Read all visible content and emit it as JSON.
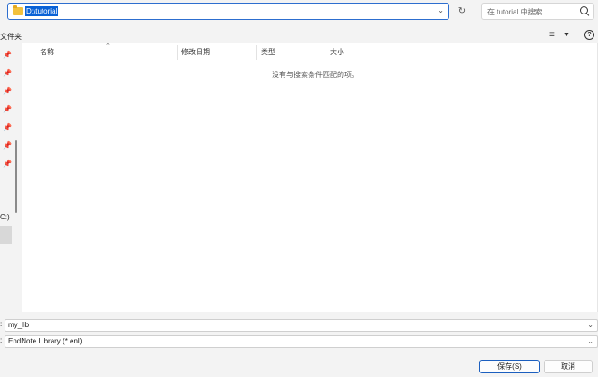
{
  "address": {
    "path": "D:\\tutorial"
  },
  "search": {
    "placeholder": "在 tutorial 中搜索"
  },
  "toolbar": {
    "left_label": "文件夹"
  },
  "nav": {
    "drive_label": "C:)"
  },
  "columns": [
    {
      "label": "名称"
    },
    {
      "label": "修改日期"
    },
    {
      "label": "类型"
    },
    {
      "label": "大小"
    }
  ],
  "file_list": {
    "empty_message": "没有与搜索条件匹配的项。"
  },
  "filename": {
    "label": ":",
    "value": "my_lib"
  },
  "filetype": {
    "label": ":",
    "value": "EndNote Library (*.enl)"
  },
  "buttons": {
    "save": "保存(S)",
    "cancel": "取消"
  },
  "icons": {
    "folder": "folder-icon",
    "refresh": "refresh-icon",
    "search": "search-icon",
    "view": "view-options-icon",
    "help": "help-icon",
    "pin": "pin-icon"
  },
  "colors": {
    "accent": "#0a62d6",
    "selection": "#0a62d6"
  }
}
